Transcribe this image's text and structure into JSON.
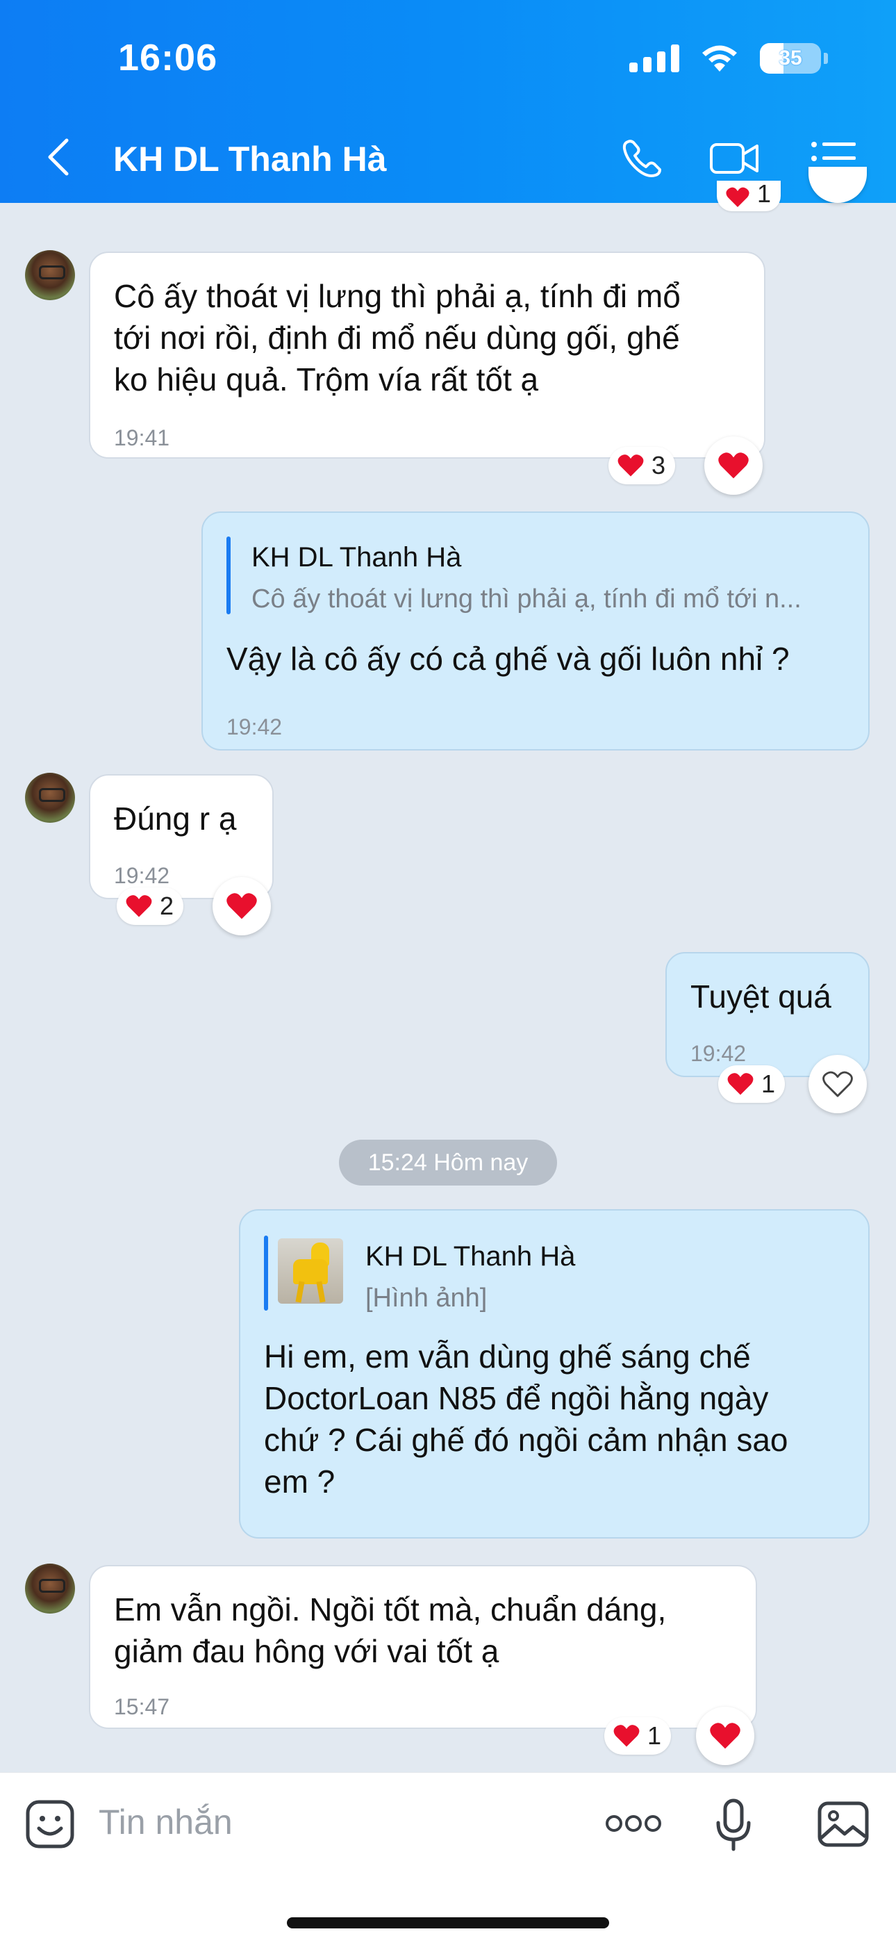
{
  "status": {
    "time": "16:06",
    "battery": "35"
  },
  "header": {
    "title": "KH DL Thanh Hà"
  },
  "messages": [
    {
      "text": "Cô ấy thoát vị lưng thì phải ạ, tính đi mổ\ntới nơi rồi, định đi mổ nếu dùng gối, ghế\nko hiệu quả. Trộm vía rất tốt ạ",
      "time": "19:41",
      "reaction_count": "3"
    },
    {
      "reply_name": "KH DL Thanh Hà",
      "reply_text": "Cô ấy thoát vị lưng thì phải ạ, tính đi mổ tới n...",
      "text": "Vậy là cô ấy có cả ghế và gối luôn nhỉ ?",
      "time": "19:42"
    },
    {
      "text": "Đúng r ạ",
      "time": "19:42",
      "reaction_count": "2"
    },
    {
      "text": "Tuyệt quá",
      "time": "19:42",
      "reaction_count": "1"
    },
    {
      "reply_name": "KH DL Thanh Hà",
      "reply_text": "[Hình ảnh]",
      "text": "Hi em, em vẫn dùng ghế sáng chế\nDoctorLoan N85 để ngồi hằng ngày\nchứ ? Cái ghế đó ngồi cảm nhận sao\nem ?"
    },
    {
      "text": "Em vẫn ngồi. Ngồi tốt mà, chuẩn dáng,\ngiảm đau hông với vai tốt ạ",
      "time": "15:47",
      "reaction_count": "1"
    }
  ],
  "top_partial_reaction_count": "1",
  "date_divider": "15:24 Hôm nay",
  "input": {
    "placeholder": "Tin nhắn"
  },
  "icons": {
    "back": "chevron-left-icon",
    "call": "phone-icon",
    "video": "video-camera-icon",
    "menu": "list-menu-icon",
    "sticker": "sticker-icon",
    "more": "more-dots-icon",
    "mic": "microphone-icon",
    "image": "image-icon",
    "heart": "heart-icon",
    "heart_outline": "heart-outline-icon"
  },
  "colors": {
    "header": "#0a8cf7",
    "my_bubble": "#d2ecfc",
    "their_bubble": "#ffffff",
    "heart": "#e8102d"
  }
}
